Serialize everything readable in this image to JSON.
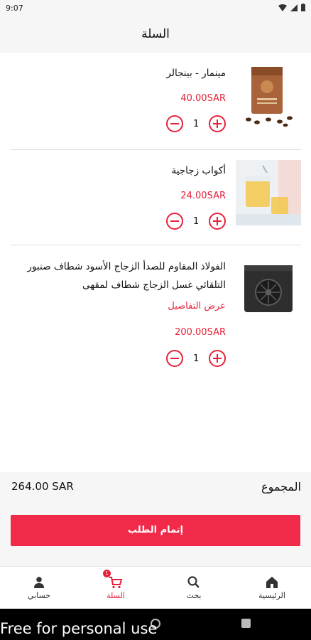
{
  "status": {
    "time": "9:07"
  },
  "header": {
    "title": "السلة"
  },
  "items": [
    {
      "name": "مينمار - بينجالر",
      "price": "40.00SAR",
      "qty": "1",
      "image_icon": "coffee-bag-image"
    },
    {
      "name": "أكواب زجاجية",
      "price": "24.00SAR",
      "qty": "1",
      "image_icon": "glass-cups-image"
    },
    {
      "name": "الفولاذ المقاوم للصدأ الزجاج الأسود شطاف صنبور التلقائي غسل الزجاج شطاف لمقهى",
      "details_link": "عرض التفاصيل",
      "price": "200.00SAR",
      "qty": "1",
      "image_icon": "glass-rinser-image"
    }
  ],
  "summary": {
    "total_label": "المجموع",
    "total_value": "264.00 SAR"
  },
  "checkout": {
    "label": "إتمام الطلب"
  },
  "nav": {
    "home": "الرئيسية",
    "search": "بحث",
    "cart": "السلة",
    "cart_badge": "1",
    "account": "حسابي"
  },
  "watermark": "Free for personal use",
  "colors": {
    "accent": "#e8213a",
    "button": "#f22a4a"
  }
}
